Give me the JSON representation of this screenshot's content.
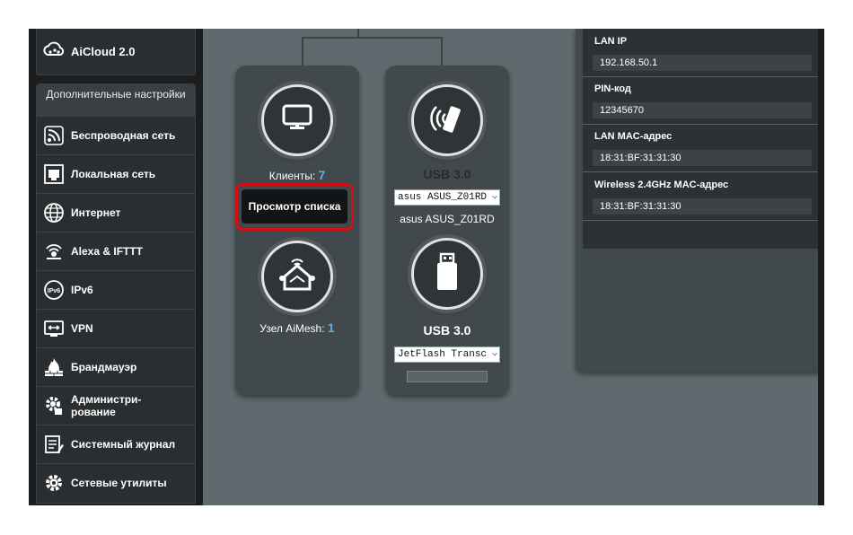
{
  "sidebar": {
    "aicloud_label": "AiCloud 2.0",
    "advanced_heading": "Дополнительные настройки",
    "items": [
      {
        "label": "Беспроводная сеть",
        "icon": "wireless-icon"
      },
      {
        "label": "Локальная сеть",
        "icon": "lan-icon"
      },
      {
        "label": "Интернет",
        "icon": "globe-icon"
      },
      {
        "label": "Alexa & IFTTT",
        "icon": "alexa-icon"
      },
      {
        "label": "IPv6",
        "icon": "ipv6-icon"
      },
      {
        "label": "VPN",
        "icon": "vpn-icon"
      },
      {
        "label": "Брандмауэр",
        "icon": "firewall-icon"
      },
      {
        "label": "Админи­стри-\nрование",
        "icon": "admin-gear-icon"
      },
      {
        "label": "Системный журнал",
        "icon": "log-icon"
      },
      {
        "label": "Сетевые утилиты",
        "icon": "tools-gear-icon"
      }
    ]
  },
  "clients_card": {
    "clients_label": "Клиенты:",
    "clients_count": "7",
    "view_list_button": "Просмотр списка",
    "aimesh_label": "Узел AiMesh:",
    "aimesh_count": "1"
  },
  "usb_card": {
    "usb1_title": "USB 3.0",
    "usb1_select": "asus ASUS_Z01RD",
    "usb1_device": "asus ASUS_Z01RD",
    "usb2_title": "USB 3.0",
    "usb2_select": "JetFlash Transc"
  },
  "info": {
    "rows": [
      {
        "label": "LAN IP",
        "value": "192.168.50.1"
      },
      {
        "label": "PIN-код",
        "value": "12345670"
      },
      {
        "label": "LAN MAC-адрес",
        "value": "18:31:BF:31:31:30"
      },
      {
        "label": "Wireless 2.4GHz MAC-адрес",
        "value": "18:31:BF:31:31:30"
      }
    ]
  },
  "colors": {
    "accent_blue": "#5cb0de",
    "highlight_red": "#d40f14"
  }
}
